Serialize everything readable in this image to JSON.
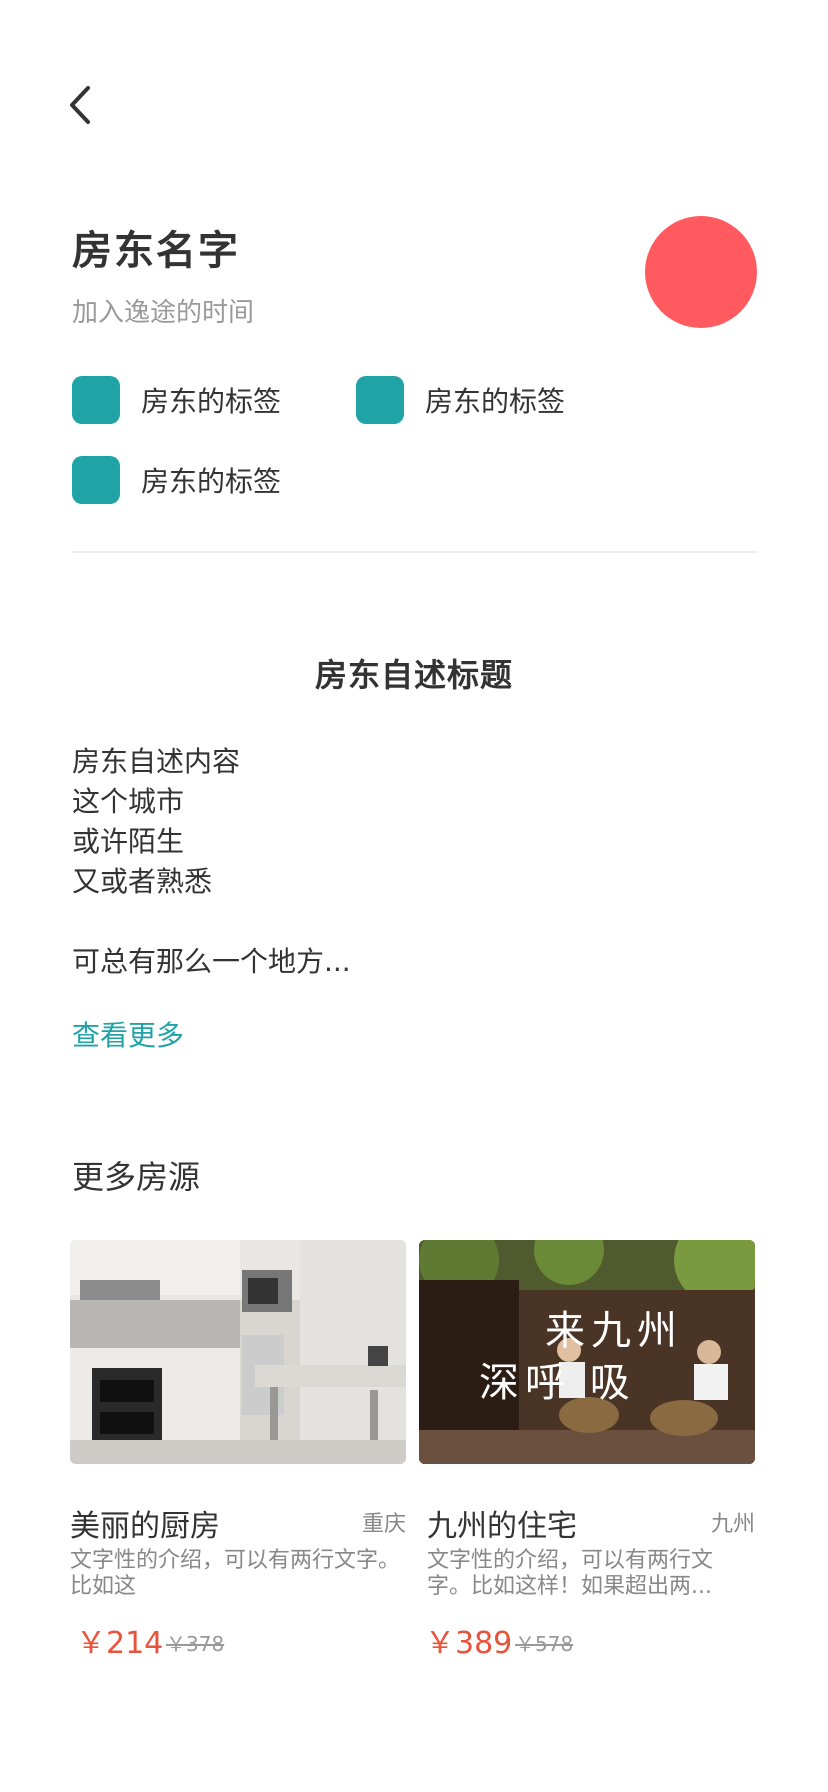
{
  "nav": {
    "back_icon": "chevron-left-icon"
  },
  "host": {
    "name": "房东名字",
    "join_time": "加入逸途的时间",
    "avatar_color": "#ff5a5f"
  },
  "tags": [
    {
      "label": "房东的标签",
      "color": "#1fa3a6"
    },
    {
      "label": "房东的标签",
      "color": "#1fa3a6"
    },
    {
      "label": "房东的标签",
      "color": "#1fa3a6"
    }
  ],
  "intro": {
    "title": "房东自述标题",
    "lines": [
      "房东自述内容",
      "这个城市",
      "或许陌生",
      "又或者熟悉",
      "",
      "可总有那么一个地方..."
    ],
    "see_more": "查看更多",
    "accent": "#1fa3a6"
  },
  "more_listings": {
    "title": "更多房源",
    "items": [
      {
        "name": "美丽的厨房",
        "city": "重庆",
        "desc": "文字性的介绍，可以有两行文字。比如这",
        "price": "￥214",
        "original_price": "￥378"
      },
      {
        "name": "九州的住宅",
        "city": "九州",
        "desc": "文字性的介绍，可以有两行文字。比如这样！如果超出两...",
        "price": "￥389",
        "original_price": "￥578",
        "photo_text_1": "来九州",
        "photo_text_2": "深呼 吸"
      }
    ],
    "price_color": "#e8533b"
  }
}
